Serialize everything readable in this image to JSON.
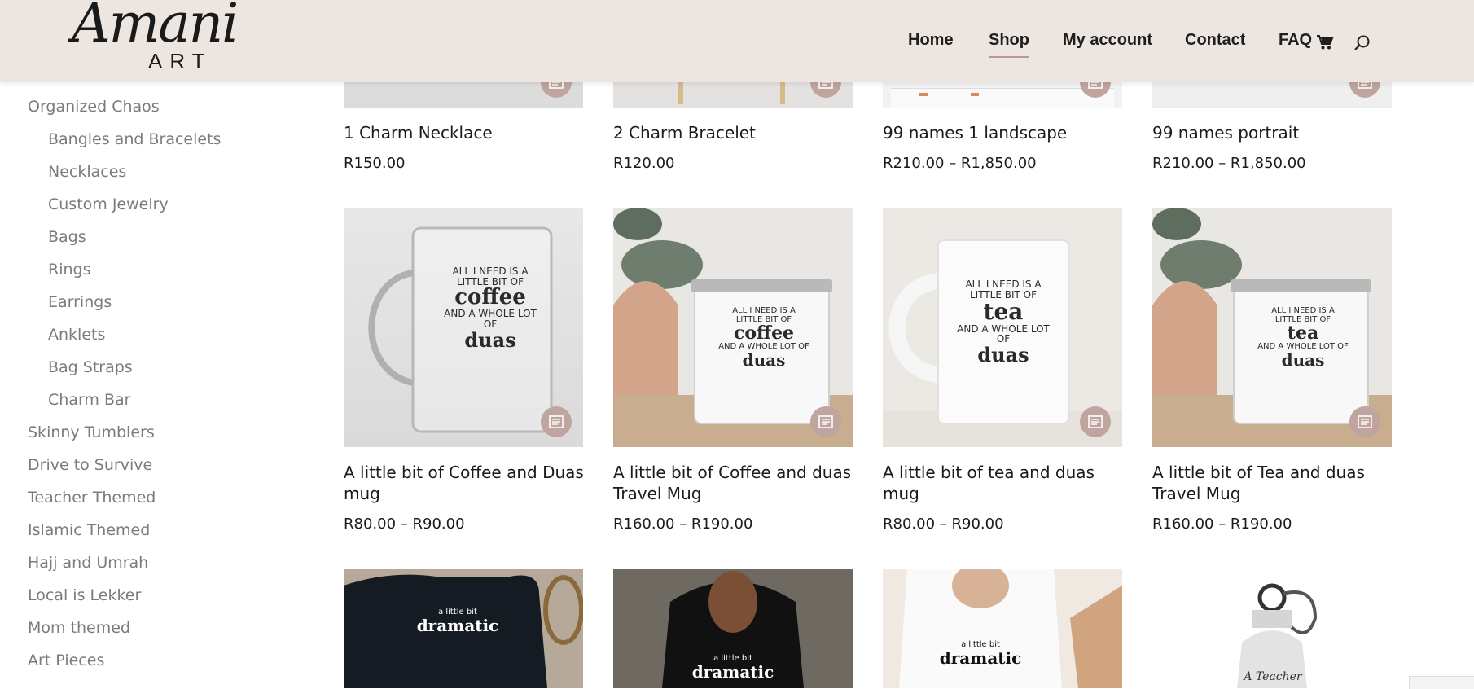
{
  "brand": {
    "logo_script": "Amani",
    "logo_sub": "ART"
  },
  "nav": {
    "home": "Home",
    "shop": "Shop",
    "my_account": "My account",
    "contact": "Contact",
    "faq": "FAQ"
  },
  "icons": {
    "cart": "cart-icon",
    "search": "search-icon",
    "quick_view": "list-icon"
  },
  "colors": {
    "header_bg": "#ede5e0",
    "accent": "#bfa49f",
    "text": "#1b1b1b",
    "sidebar_text": "#7b7b7b"
  },
  "sidebar": {
    "categories": [
      {
        "label": "Organized Chaos",
        "level": 0
      },
      {
        "label": "Bangles and Bracelets",
        "level": 1
      },
      {
        "label": "Necklaces",
        "level": 1
      },
      {
        "label": "Custom Jewelry",
        "level": 1
      },
      {
        "label": "Bags",
        "level": 1
      },
      {
        "label": "Rings",
        "level": 1
      },
      {
        "label": "Earrings",
        "level": 1
      },
      {
        "label": "Anklets",
        "level": 1
      },
      {
        "label": "Bag Straps",
        "level": 1
      },
      {
        "label": "Charm Bar",
        "level": 1
      },
      {
        "label": "Skinny Tumblers",
        "level": 0
      },
      {
        "label": "Drive to Survive",
        "level": 0
      },
      {
        "label": "Teacher Themed",
        "level": 0
      },
      {
        "label": "Islamic Themed",
        "level": 0
      },
      {
        "label": "Hajj and Umrah",
        "level": 0
      },
      {
        "label": "Local is Lekker",
        "level": 0
      },
      {
        "label": "Mom themed",
        "level": 0
      },
      {
        "label": "Art Pieces",
        "level": 0
      }
    ]
  },
  "products": {
    "row1": [
      {
        "name": "1 Charm Necklace",
        "price": "R150.00"
      },
      {
        "name": "2 Charm Bracelet",
        "price": "R120.00"
      },
      {
        "name": "99 names 1 landscape",
        "price": "R210.00 – R1,850.00"
      },
      {
        "name": "99 names portrait",
        "price": "R210.00 – R1,850.00"
      }
    ],
    "row2": [
      {
        "name": "A little bit of Coffee and Duas mug",
        "price": "R80.00 – R90.00",
        "mug_lines": [
          "ALL I NEED IS A",
          "LITTLE BIT OF",
          "coffee",
          "AND A WHOLE LOT OF",
          "duas"
        ]
      },
      {
        "name": "A little bit of Coffee and duas Travel Mug",
        "price": "R160.00 – R190.00",
        "mug_lines": [
          "ALL I NEED IS A",
          "LITTLE BIT OF",
          "coffee",
          "AND A WHOLE LOT OF",
          "duas"
        ]
      },
      {
        "name": "A little bit of tea and duas mug",
        "price": "R80.00 – R90.00",
        "mug_lines": [
          "ALL I NEED IS A",
          "LITTLE BIT OF",
          "tea",
          "AND A WHOLE LOT OF",
          "duas"
        ]
      },
      {
        "name": "A little bit of Tea and duas Travel Mug",
        "price": "R160.00 – R190.00",
        "mug_lines": [
          "ALL I NEED IS A",
          "LITTLE BIT OF",
          "tea",
          "AND A WHOLE LOT OF",
          "duas"
        ]
      }
    ],
    "row3": [
      {
        "shirt_text_small": "a little bit",
        "shirt_text_big": "dramatic"
      },
      {
        "shirt_text_small": "a little bit",
        "shirt_text_big": "dramatic"
      },
      {
        "shirt_text_small": "a little bit",
        "shirt_text_big": "dramatic"
      },
      {
        "bottle_text": "A Teacher"
      }
    ]
  }
}
